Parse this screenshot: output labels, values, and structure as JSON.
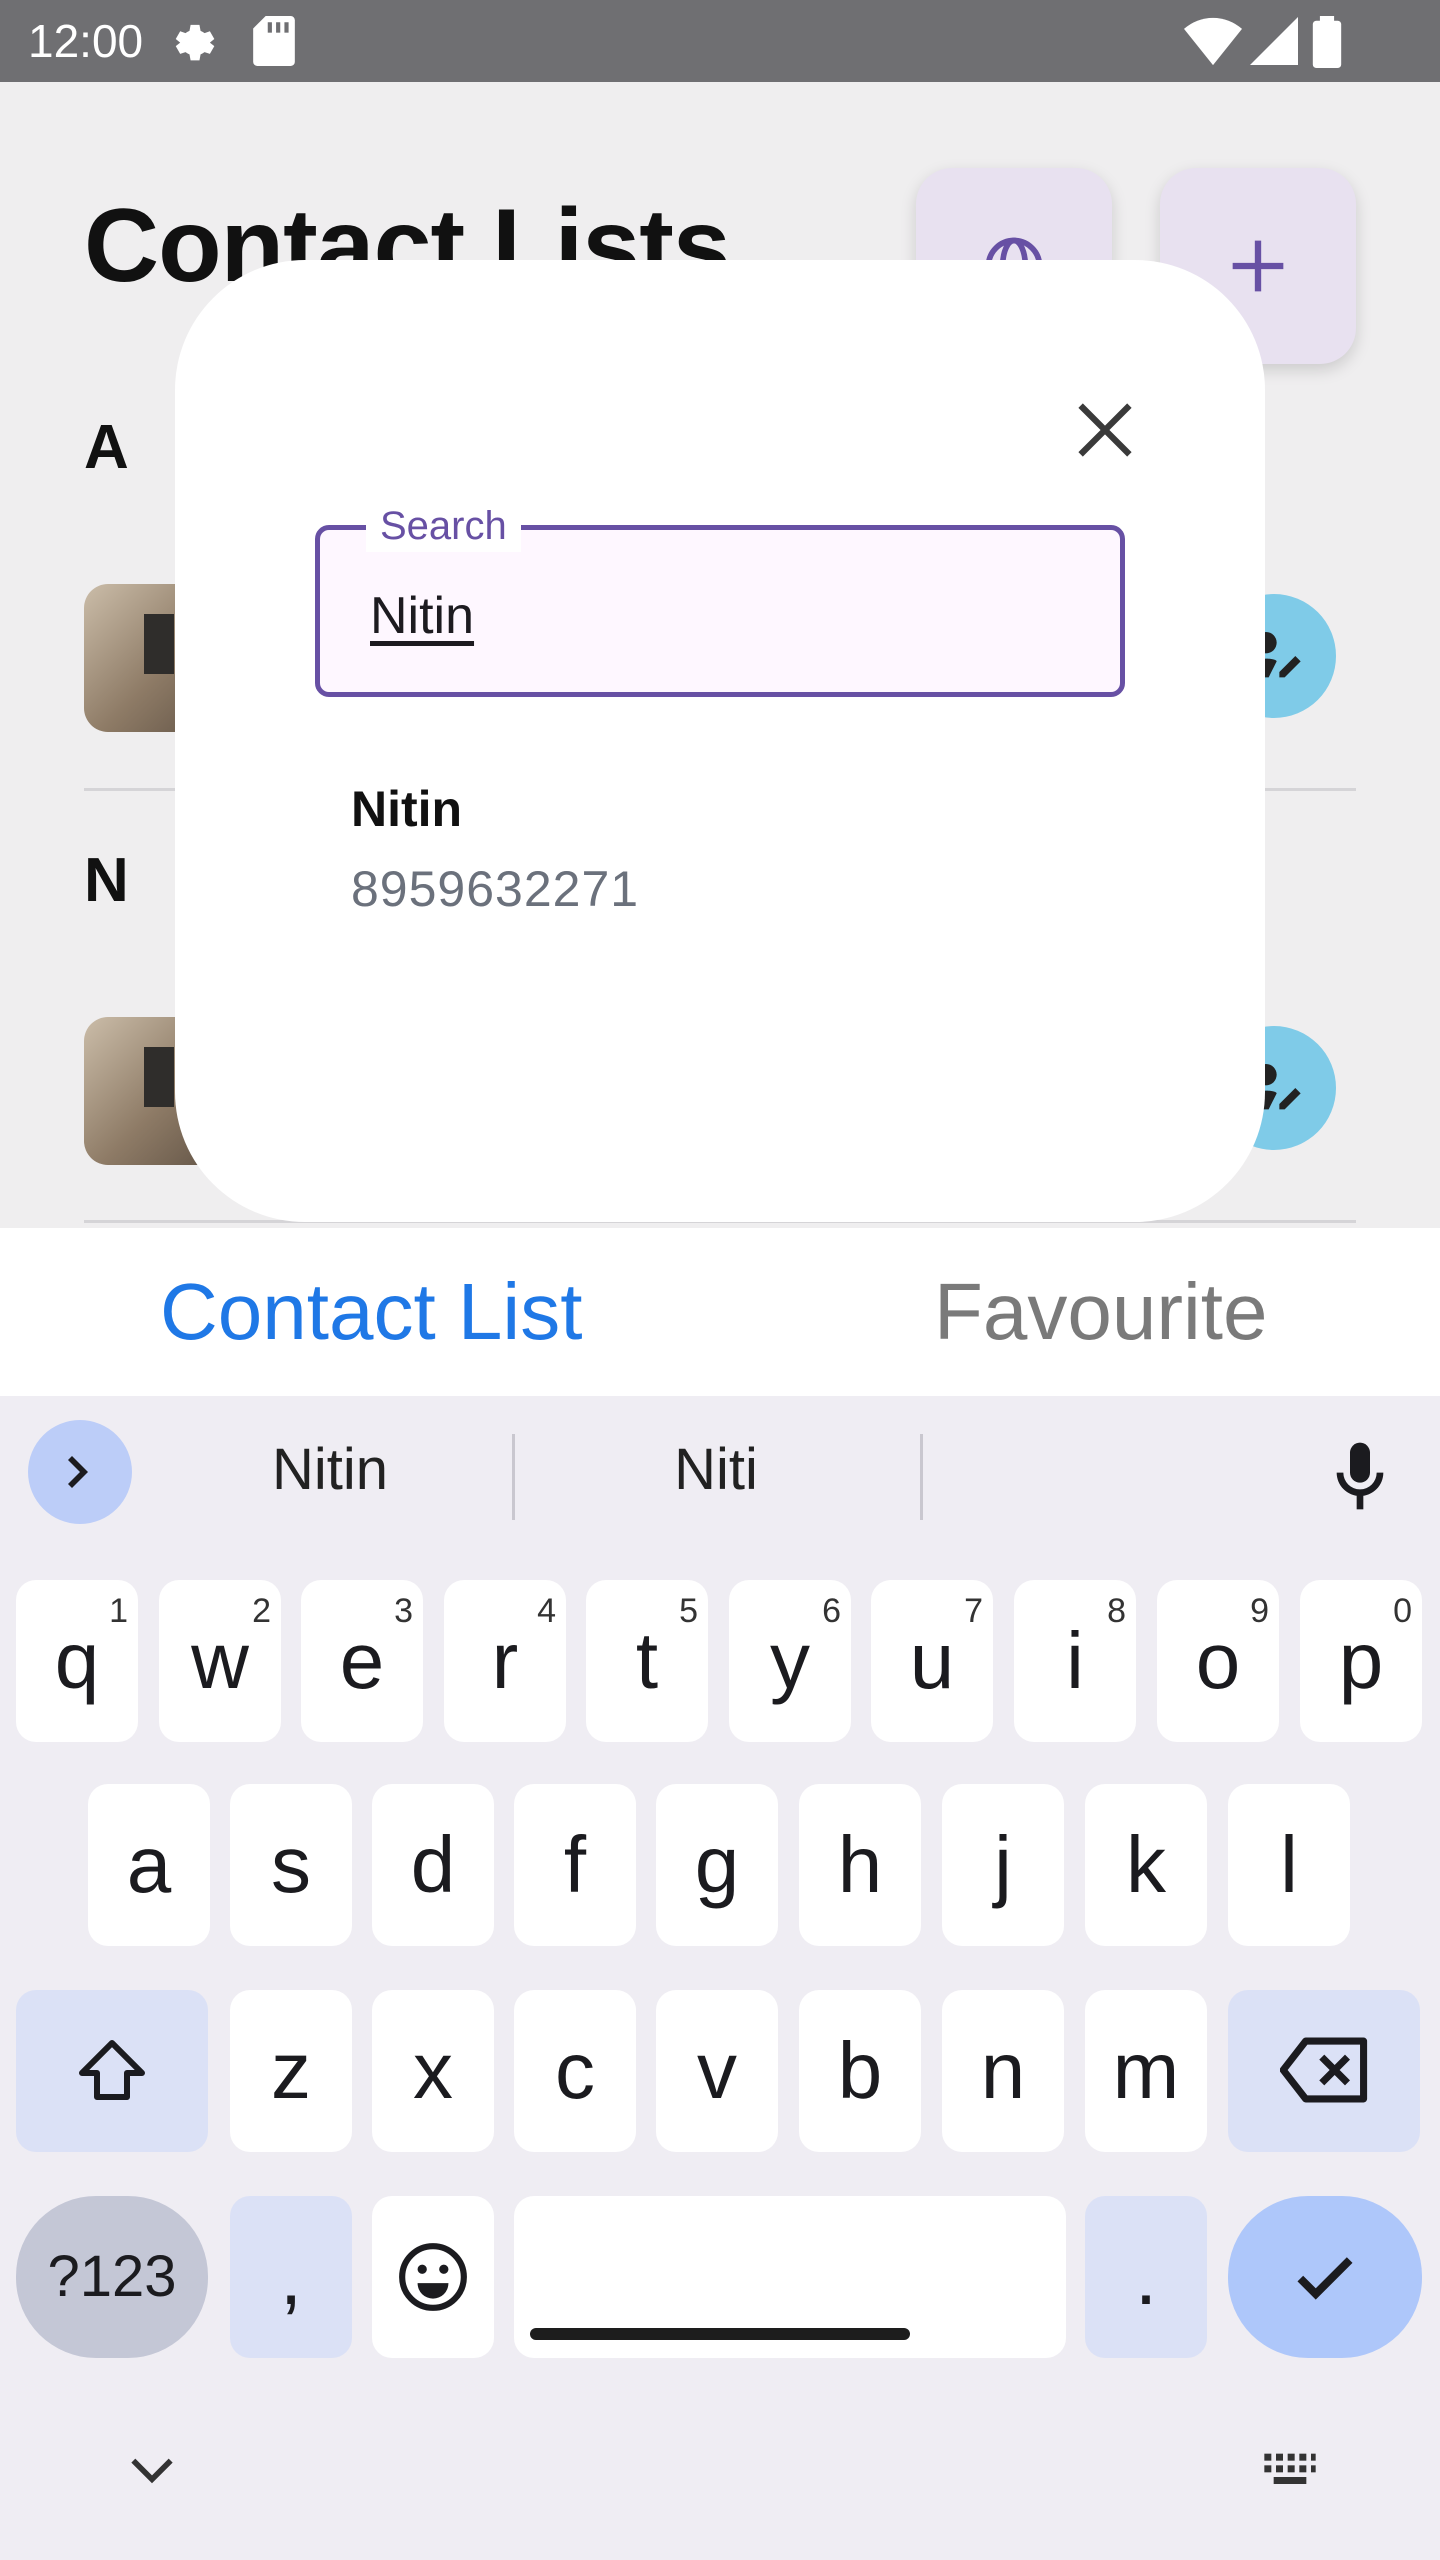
{
  "status_bar": {
    "time": "12:00"
  },
  "app": {
    "title": "Contact Lists",
    "sections": [
      {
        "letter": "A"
      },
      {
        "letter": "N"
      }
    ]
  },
  "dialog": {
    "search": {
      "label": "Search",
      "value": "Nitin"
    },
    "results": [
      {
        "name": "Nitin",
        "phone": "8959632271"
      }
    ]
  },
  "tabs": {
    "contacts": "Contact List",
    "favourite": "Favourite"
  },
  "keyboard": {
    "suggestions": [
      "Nitin",
      "Niti",
      ""
    ],
    "row1": [
      {
        "k": "q",
        "h": "1"
      },
      {
        "k": "w",
        "h": "2"
      },
      {
        "k": "e",
        "h": "3"
      },
      {
        "k": "r",
        "h": "4"
      },
      {
        "k": "t",
        "h": "5"
      },
      {
        "k": "y",
        "h": "6"
      },
      {
        "k": "u",
        "h": "7"
      },
      {
        "k": "i",
        "h": "8"
      },
      {
        "k": "o",
        "h": "9"
      },
      {
        "k": "p",
        "h": "0"
      }
    ],
    "row2": [
      "a",
      "s",
      "d",
      "f",
      "g",
      "h",
      "j",
      "k",
      "l"
    ],
    "row3": [
      "z",
      "x",
      "c",
      "v",
      "b",
      "n",
      "m"
    ],
    "symbols_label": "?123",
    "comma": ",",
    "period": "."
  },
  "colors": {
    "accent": "#6750a4",
    "tab_active": "#1f78e6",
    "tab_inactive": "#7a7a7a"
  }
}
